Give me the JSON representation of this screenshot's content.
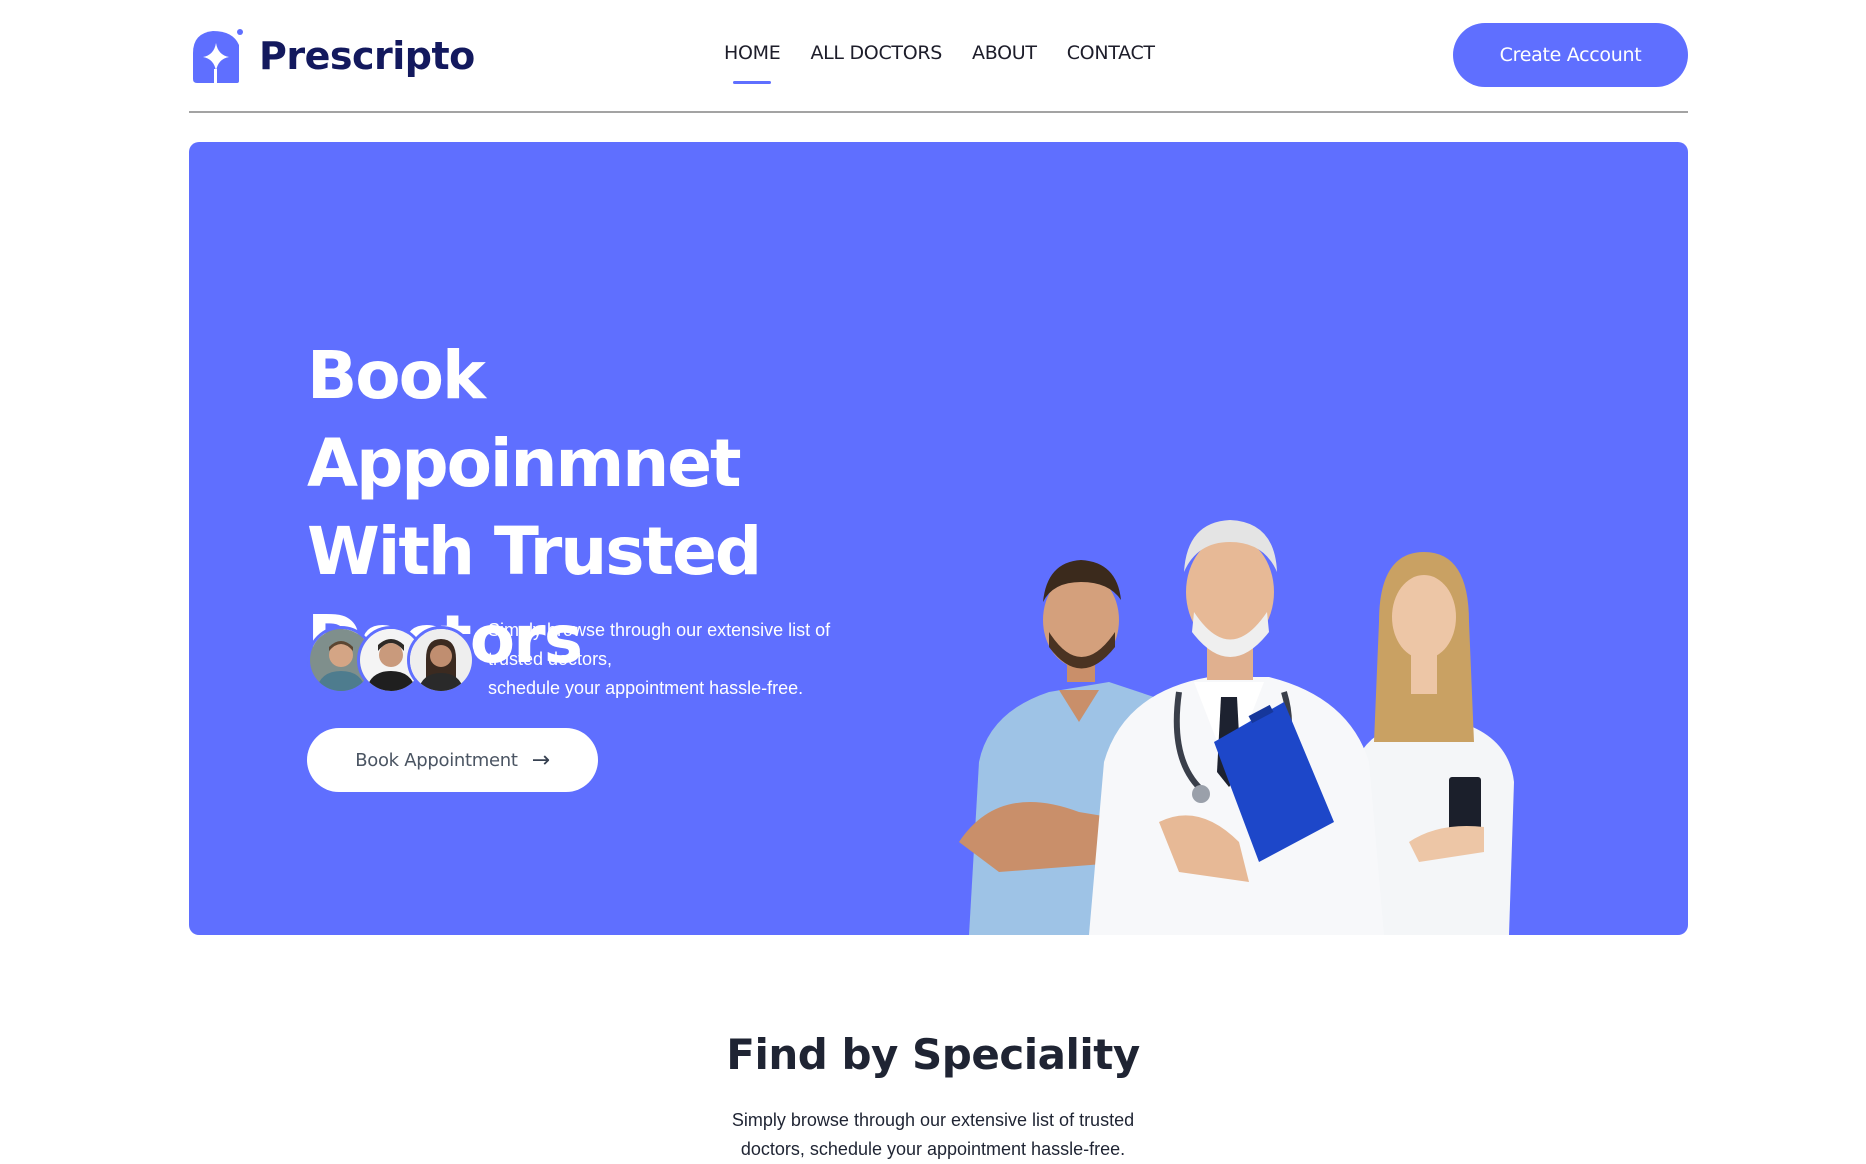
{
  "brand": {
    "name": "Prescripto",
    "accent": "#5f6fff",
    "navy": "#13195e"
  },
  "nav": {
    "items": [
      {
        "label": "HOME",
        "active": true
      },
      {
        "label": "ALL DOCTORS",
        "active": false
      },
      {
        "label": "ABOUT",
        "active": false
      },
      {
        "label": "CONTACT",
        "active": false
      }
    ],
    "cta": "Create Account"
  },
  "hero": {
    "title_lines": [
      "Book Appoinmnet",
      "With Trusted",
      "Doctors"
    ],
    "subtitle_lines": [
      "Simply browse through our extensive list of",
      "trusted doctors,",
      "schedule your appointment hassle-free."
    ],
    "button": "Book Appointment",
    "button_icon": "arrow-right-icon"
  },
  "speciality": {
    "title": "Find by Speciality",
    "subtitle_lines": [
      "Simply browse through our extensive list of trusted",
      "doctors, schedule your appointment hassle-free."
    ]
  }
}
